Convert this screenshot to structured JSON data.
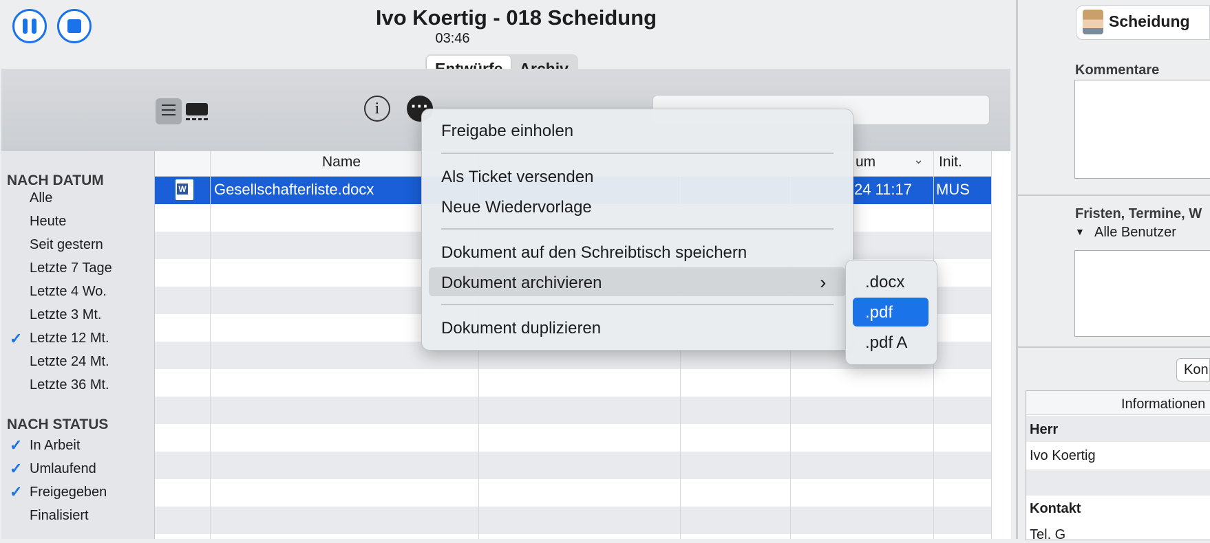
{
  "header": {
    "title": "Ivo Koertig - 018 Scheidung",
    "timer": "03:46",
    "tabs": [
      {
        "label": "Entwürfe"
      },
      {
        "label": "Archiv"
      }
    ]
  },
  "toolbar": {
    "list_view_icon": "list-icon",
    "grid_view_icon": "grid-icon",
    "info_icon": "info-icon",
    "more_icon": "ellipsis-icon",
    "search_placeholder": ""
  },
  "sidebar": {
    "date_header": "NACH DATUM",
    "date_items": [
      {
        "label": "Alle",
        "checked": false
      },
      {
        "label": "Heute",
        "checked": false
      },
      {
        "label": "Seit gestern",
        "checked": false
      },
      {
        "label": "Letzte 7 Tage",
        "checked": false
      },
      {
        "label": "Letzte 4 Wo.",
        "checked": false
      },
      {
        "label": "Letzte 3 Mt.",
        "checked": false
      },
      {
        "label": "Letzte 12 Mt.",
        "checked": true
      },
      {
        "label": "Letzte 24 Mt.",
        "checked": false
      },
      {
        "label": "Letzte 36 Mt.",
        "checked": false
      }
    ],
    "status_header": "NACH STATUS",
    "status_items": [
      {
        "label": "In Arbeit",
        "checked": true
      },
      {
        "label": "Umlaufend",
        "checked": true
      },
      {
        "label": "Freigegeben",
        "checked": true
      },
      {
        "label": "Finalisiert",
        "checked": false
      }
    ],
    "check_glyph": "✓"
  },
  "table": {
    "columns": [
      "Name",
      "um",
      "Init."
    ],
    "rows": [
      {
        "name": "Gesellschafterliste.docx",
        "date": "24 11:17",
        "init": "MUS",
        "selected": true
      }
    ]
  },
  "context_menu": {
    "items": [
      "Freigabe einholen",
      "Als Ticket versenden",
      "Neue Wiedervorlage",
      "Dokument auf den Schreibtisch speichern",
      "Dokument archivieren",
      "Dokument duplizieren"
    ],
    "submenu_arrow": "›",
    "submenu": [
      ".docx",
      ".pdf",
      ".pdf A"
    ],
    "submenu_selected": ".pdf"
  },
  "right_pane": {
    "case_label": "Scheidung",
    "comments_label": "Kommentare",
    "deadlines_label": "Fristen, Termine, W",
    "users_filter": "Alle Benutzer",
    "kon_button": "Kon",
    "info_header": "Informationen",
    "salutation_label": "Herr",
    "client_name": "Ivo Koertig",
    "contact_label": "Kontakt",
    "phone_label": "Tel. G"
  },
  "colors": {
    "accent": "#1a73e8",
    "selection": "#1a5fd8"
  }
}
